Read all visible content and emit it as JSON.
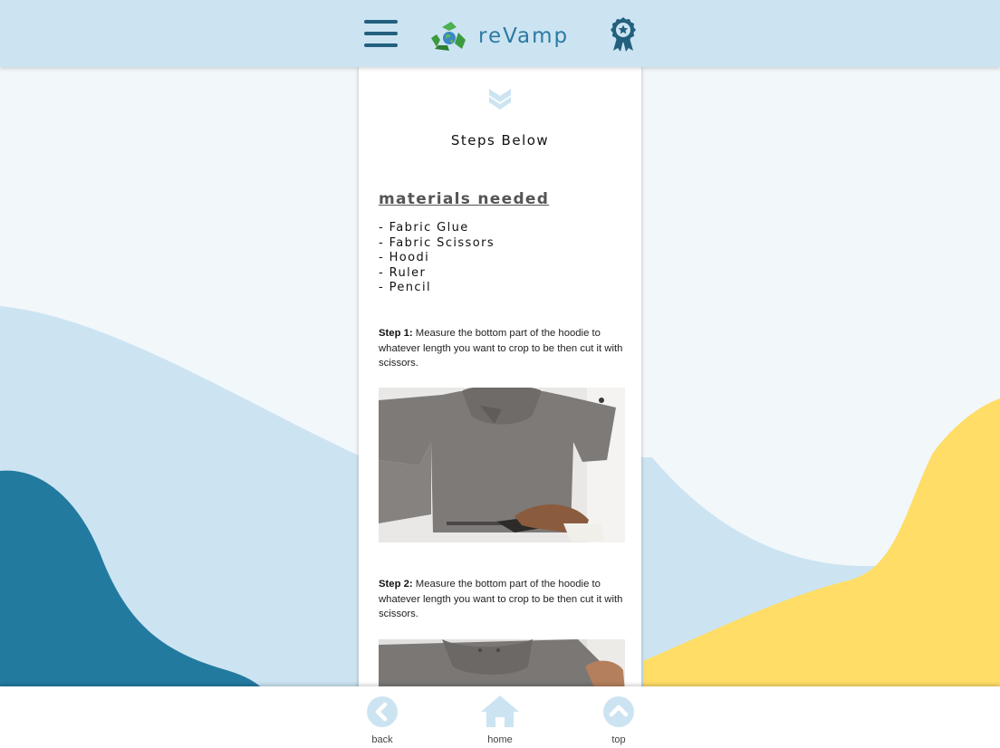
{
  "header": {
    "app_name": "reVamp",
    "menu_icon": "hamburger-menu-icon",
    "logo_icon": "recycle-globe-icon",
    "badge_icon": "award-ribbon-icon"
  },
  "content": {
    "scroll_icon": "double-chevron-down-icon",
    "steps_heading": "Steps Below",
    "materials_title": "materials needed",
    "materials": [
      "- Fabric Glue",
      "- Fabric Scissors",
      "- Hoodi",
      "- Ruler",
      "- Pencil"
    ],
    "steps": [
      {
        "label": "Step 1:",
        "text": " Measure the bottom part of the hoodie to whatever length you want to crop to be then cut it with scissors."
      },
      {
        "label": "Step 2:",
        "text": " Measure the bottom part of the hoodie to whatever length you want to crop to be then cut it with scissors."
      }
    ]
  },
  "bottom_nav": {
    "back_label": "back",
    "home_label": "home",
    "top_label": "top"
  },
  "colors": {
    "header_bg": "#cce4f2",
    "brand_text": "#2c7aa3",
    "dark_blue": "#22607e",
    "light_blue": "#cce4f2",
    "wave_teal": "#227a9f",
    "wave_yellow": "#ffdd66",
    "nav_icon": "#cce4f2"
  }
}
